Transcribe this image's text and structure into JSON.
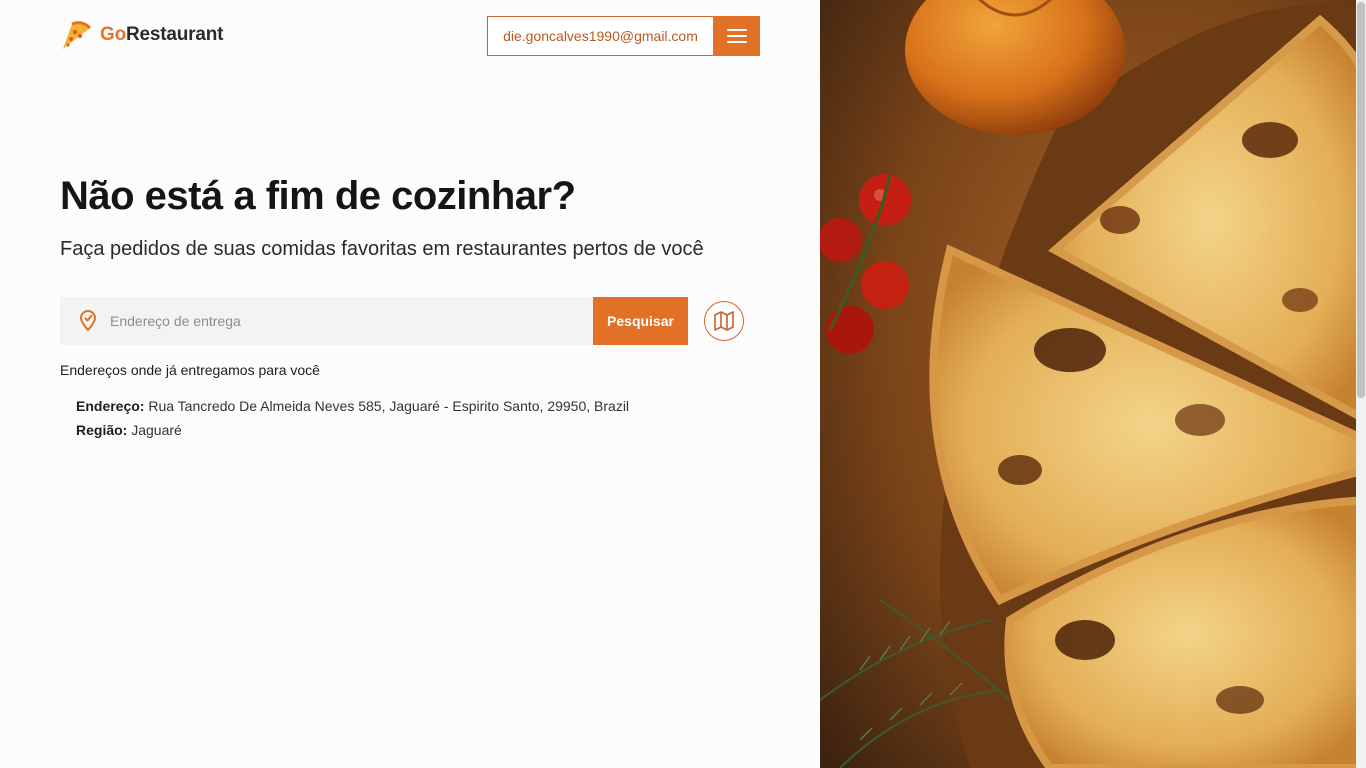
{
  "header": {
    "logo": {
      "prefix": "Go",
      "suffix": "Restaurant",
      "icon": "pizza-slice-icon"
    },
    "user_email": "die.goncalves1990@gmail.com",
    "menu_icon": "hamburger-menu-icon"
  },
  "hero": {
    "title": "Não está a fim de cozinhar?",
    "subtitle": "Faça pedidos de suas comidas favoritas em restaurantes pertos de você"
  },
  "search": {
    "placeholder": "Endereço de entrega",
    "value": "",
    "button_label": "Pesquisar",
    "pin_icon": "location-pin-icon",
    "map_icon": "map-icon"
  },
  "delivered": {
    "title": "Endereços onde já entregamos para você",
    "address_label": "Endereço:",
    "address_value": "Rua Tancredo De Almeida Neves 585, Jaguaré - Espirito Santo, 29950, Brazil",
    "region_label": "Região:",
    "region_value": "Jaguaré"
  },
  "colors": {
    "accent": "#e07127",
    "accent_dark": "#b95a22",
    "background": "#fdfcfc"
  },
  "hero_image": {
    "icon": "pizza-photo"
  }
}
